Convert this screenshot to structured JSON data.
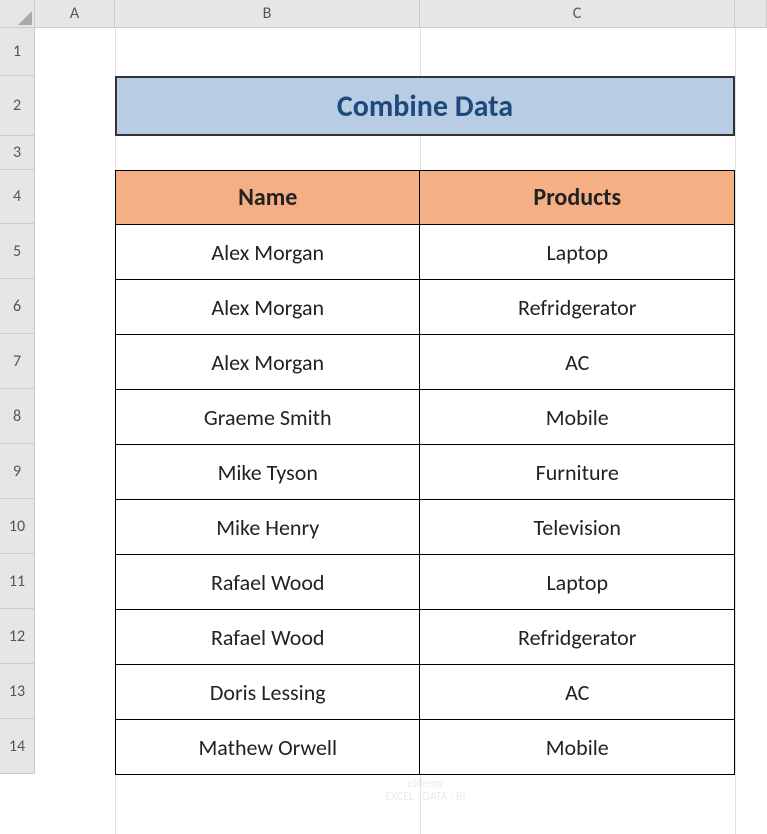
{
  "columns": [
    "A",
    "B",
    "C",
    ""
  ],
  "rows": [
    "1",
    "2",
    "3",
    "4",
    "5",
    "6",
    "7",
    "8",
    "9",
    "10",
    "11",
    "12",
    "13",
    "14"
  ],
  "title": "Combine Data",
  "headers": {
    "name": "Name",
    "products": "Products"
  },
  "data": [
    {
      "name": "Alex Morgan",
      "product": "Laptop"
    },
    {
      "name": "Alex Morgan",
      "product": "Refridgerator"
    },
    {
      "name": "Alex Morgan",
      "product": "AC"
    },
    {
      "name": "Graeme Smith",
      "product": "Mobile"
    },
    {
      "name": "Mike Tyson",
      "product": "Furniture"
    },
    {
      "name": "Mike Henry",
      "product": "Television"
    },
    {
      "name": "Rafael Wood",
      "product": "Laptop"
    },
    {
      "name": "Rafael Wood",
      "product": "Refridgerator"
    },
    {
      "name": "Doris Lessing",
      "product": "AC"
    },
    {
      "name": "Mathew Orwell",
      "product": "Mobile"
    }
  ],
  "watermark": {
    "line1": "eldemy",
    "line2": "EXCEL · DATA · BI"
  }
}
